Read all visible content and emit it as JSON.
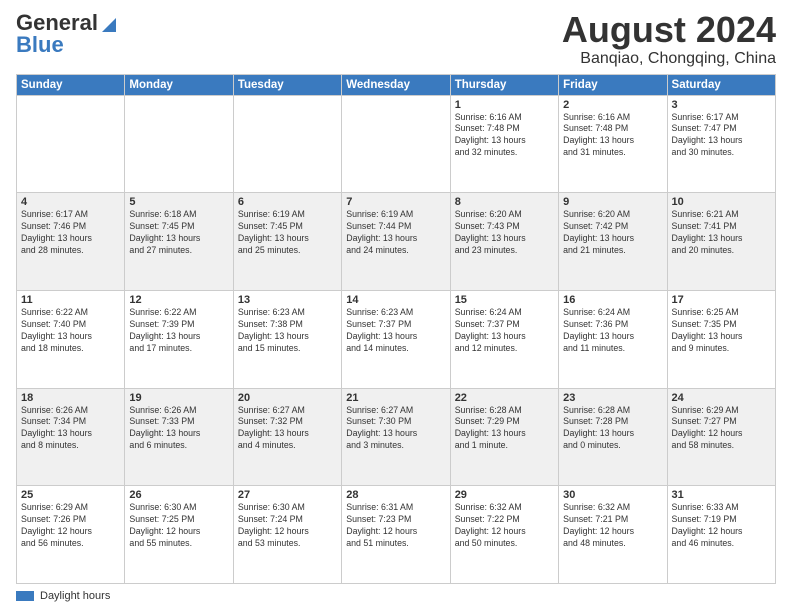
{
  "header": {
    "logo_general": "General",
    "logo_blue": "Blue",
    "month": "August 2024",
    "location": "Banqiao, Chongqing, China"
  },
  "weekdays": [
    "Sunday",
    "Monday",
    "Tuesday",
    "Wednesday",
    "Thursday",
    "Friday",
    "Saturday"
  ],
  "weeks": [
    [
      {
        "day": "",
        "info": ""
      },
      {
        "day": "",
        "info": ""
      },
      {
        "day": "",
        "info": ""
      },
      {
        "day": "",
        "info": ""
      },
      {
        "day": "1",
        "info": "Sunrise: 6:16 AM\nSunset: 7:48 PM\nDaylight: 13 hours\nand 32 minutes."
      },
      {
        "day": "2",
        "info": "Sunrise: 6:16 AM\nSunset: 7:48 PM\nDaylight: 13 hours\nand 31 minutes."
      },
      {
        "day": "3",
        "info": "Sunrise: 6:17 AM\nSunset: 7:47 PM\nDaylight: 13 hours\nand 30 minutes."
      }
    ],
    [
      {
        "day": "4",
        "info": "Sunrise: 6:17 AM\nSunset: 7:46 PM\nDaylight: 13 hours\nand 28 minutes."
      },
      {
        "day": "5",
        "info": "Sunrise: 6:18 AM\nSunset: 7:45 PM\nDaylight: 13 hours\nand 27 minutes."
      },
      {
        "day": "6",
        "info": "Sunrise: 6:19 AM\nSunset: 7:45 PM\nDaylight: 13 hours\nand 25 minutes."
      },
      {
        "day": "7",
        "info": "Sunrise: 6:19 AM\nSunset: 7:44 PM\nDaylight: 13 hours\nand 24 minutes."
      },
      {
        "day": "8",
        "info": "Sunrise: 6:20 AM\nSunset: 7:43 PM\nDaylight: 13 hours\nand 23 minutes."
      },
      {
        "day": "9",
        "info": "Sunrise: 6:20 AM\nSunset: 7:42 PM\nDaylight: 13 hours\nand 21 minutes."
      },
      {
        "day": "10",
        "info": "Sunrise: 6:21 AM\nSunset: 7:41 PM\nDaylight: 13 hours\nand 20 minutes."
      }
    ],
    [
      {
        "day": "11",
        "info": "Sunrise: 6:22 AM\nSunset: 7:40 PM\nDaylight: 13 hours\nand 18 minutes."
      },
      {
        "day": "12",
        "info": "Sunrise: 6:22 AM\nSunset: 7:39 PM\nDaylight: 13 hours\nand 17 minutes."
      },
      {
        "day": "13",
        "info": "Sunrise: 6:23 AM\nSunset: 7:38 PM\nDaylight: 13 hours\nand 15 minutes."
      },
      {
        "day": "14",
        "info": "Sunrise: 6:23 AM\nSunset: 7:37 PM\nDaylight: 13 hours\nand 14 minutes."
      },
      {
        "day": "15",
        "info": "Sunrise: 6:24 AM\nSunset: 7:37 PM\nDaylight: 13 hours\nand 12 minutes."
      },
      {
        "day": "16",
        "info": "Sunrise: 6:24 AM\nSunset: 7:36 PM\nDaylight: 13 hours\nand 11 minutes."
      },
      {
        "day": "17",
        "info": "Sunrise: 6:25 AM\nSunset: 7:35 PM\nDaylight: 13 hours\nand 9 minutes."
      }
    ],
    [
      {
        "day": "18",
        "info": "Sunrise: 6:26 AM\nSunset: 7:34 PM\nDaylight: 13 hours\nand 8 minutes."
      },
      {
        "day": "19",
        "info": "Sunrise: 6:26 AM\nSunset: 7:33 PM\nDaylight: 13 hours\nand 6 minutes."
      },
      {
        "day": "20",
        "info": "Sunrise: 6:27 AM\nSunset: 7:32 PM\nDaylight: 13 hours\nand 4 minutes."
      },
      {
        "day": "21",
        "info": "Sunrise: 6:27 AM\nSunset: 7:30 PM\nDaylight: 13 hours\nand 3 minutes."
      },
      {
        "day": "22",
        "info": "Sunrise: 6:28 AM\nSunset: 7:29 PM\nDaylight: 13 hours\nand 1 minute."
      },
      {
        "day": "23",
        "info": "Sunrise: 6:28 AM\nSunset: 7:28 PM\nDaylight: 13 hours\nand 0 minutes."
      },
      {
        "day": "24",
        "info": "Sunrise: 6:29 AM\nSunset: 7:27 PM\nDaylight: 12 hours\nand 58 minutes."
      }
    ],
    [
      {
        "day": "25",
        "info": "Sunrise: 6:29 AM\nSunset: 7:26 PM\nDaylight: 12 hours\nand 56 minutes."
      },
      {
        "day": "26",
        "info": "Sunrise: 6:30 AM\nSunset: 7:25 PM\nDaylight: 12 hours\nand 55 minutes."
      },
      {
        "day": "27",
        "info": "Sunrise: 6:30 AM\nSunset: 7:24 PM\nDaylight: 12 hours\nand 53 minutes."
      },
      {
        "day": "28",
        "info": "Sunrise: 6:31 AM\nSunset: 7:23 PM\nDaylight: 12 hours\nand 51 minutes."
      },
      {
        "day": "29",
        "info": "Sunrise: 6:32 AM\nSunset: 7:22 PM\nDaylight: 12 hours\nand 50 minutes."
      },
      {
        "day": "30",
        "info": "Sunrise: 6:32 AM\nSunset: 7:21 PM\nDaylight: 12 hours\nand 48 minutes."
      },
      {
        "day": "31",
        "info": "Sunrise: 6:33 AM\nSunset: 7:19 PM\nDaylight: 12 hours\nand 46 minutes."
      }
    ]
  ],
  "legend": {
    "daylight_label": "Daylight hours"
  }
}
